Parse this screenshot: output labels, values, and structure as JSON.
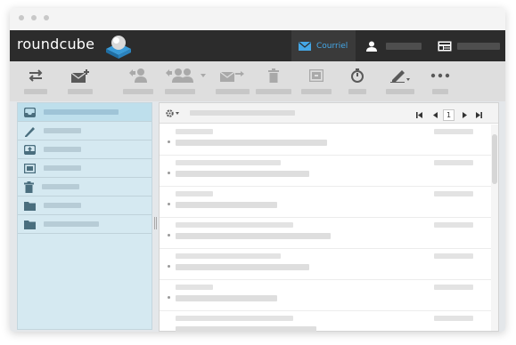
{
  "app": {
    "logo_text": "roundcube"
  },
  "taskbar": {
    "mail_label": "Courriel"
  },
  "icons": {
    "reply": "reply-icon",
    "compose": "compose-icon",
    "reply_single": "reply-sender-icon",
    "reply_all": "reply-all-icon",
    "forward": "forward-icon",
    "delete": "trash-icon",
    "archive": "archive-icon",
    "mark": "stopwatch-icon",
    "edit": "pencil-icon",
    "more": "more-icon"
  },
  "list": {
    "page_number": "1"
  },
  "colors": {
    "appbar": "#2c2c2c",
    "accent": "#45a7e6",
    "sidebar": "#d5e9f1",
    "selected_folder": "#bedfec"
  }
}
